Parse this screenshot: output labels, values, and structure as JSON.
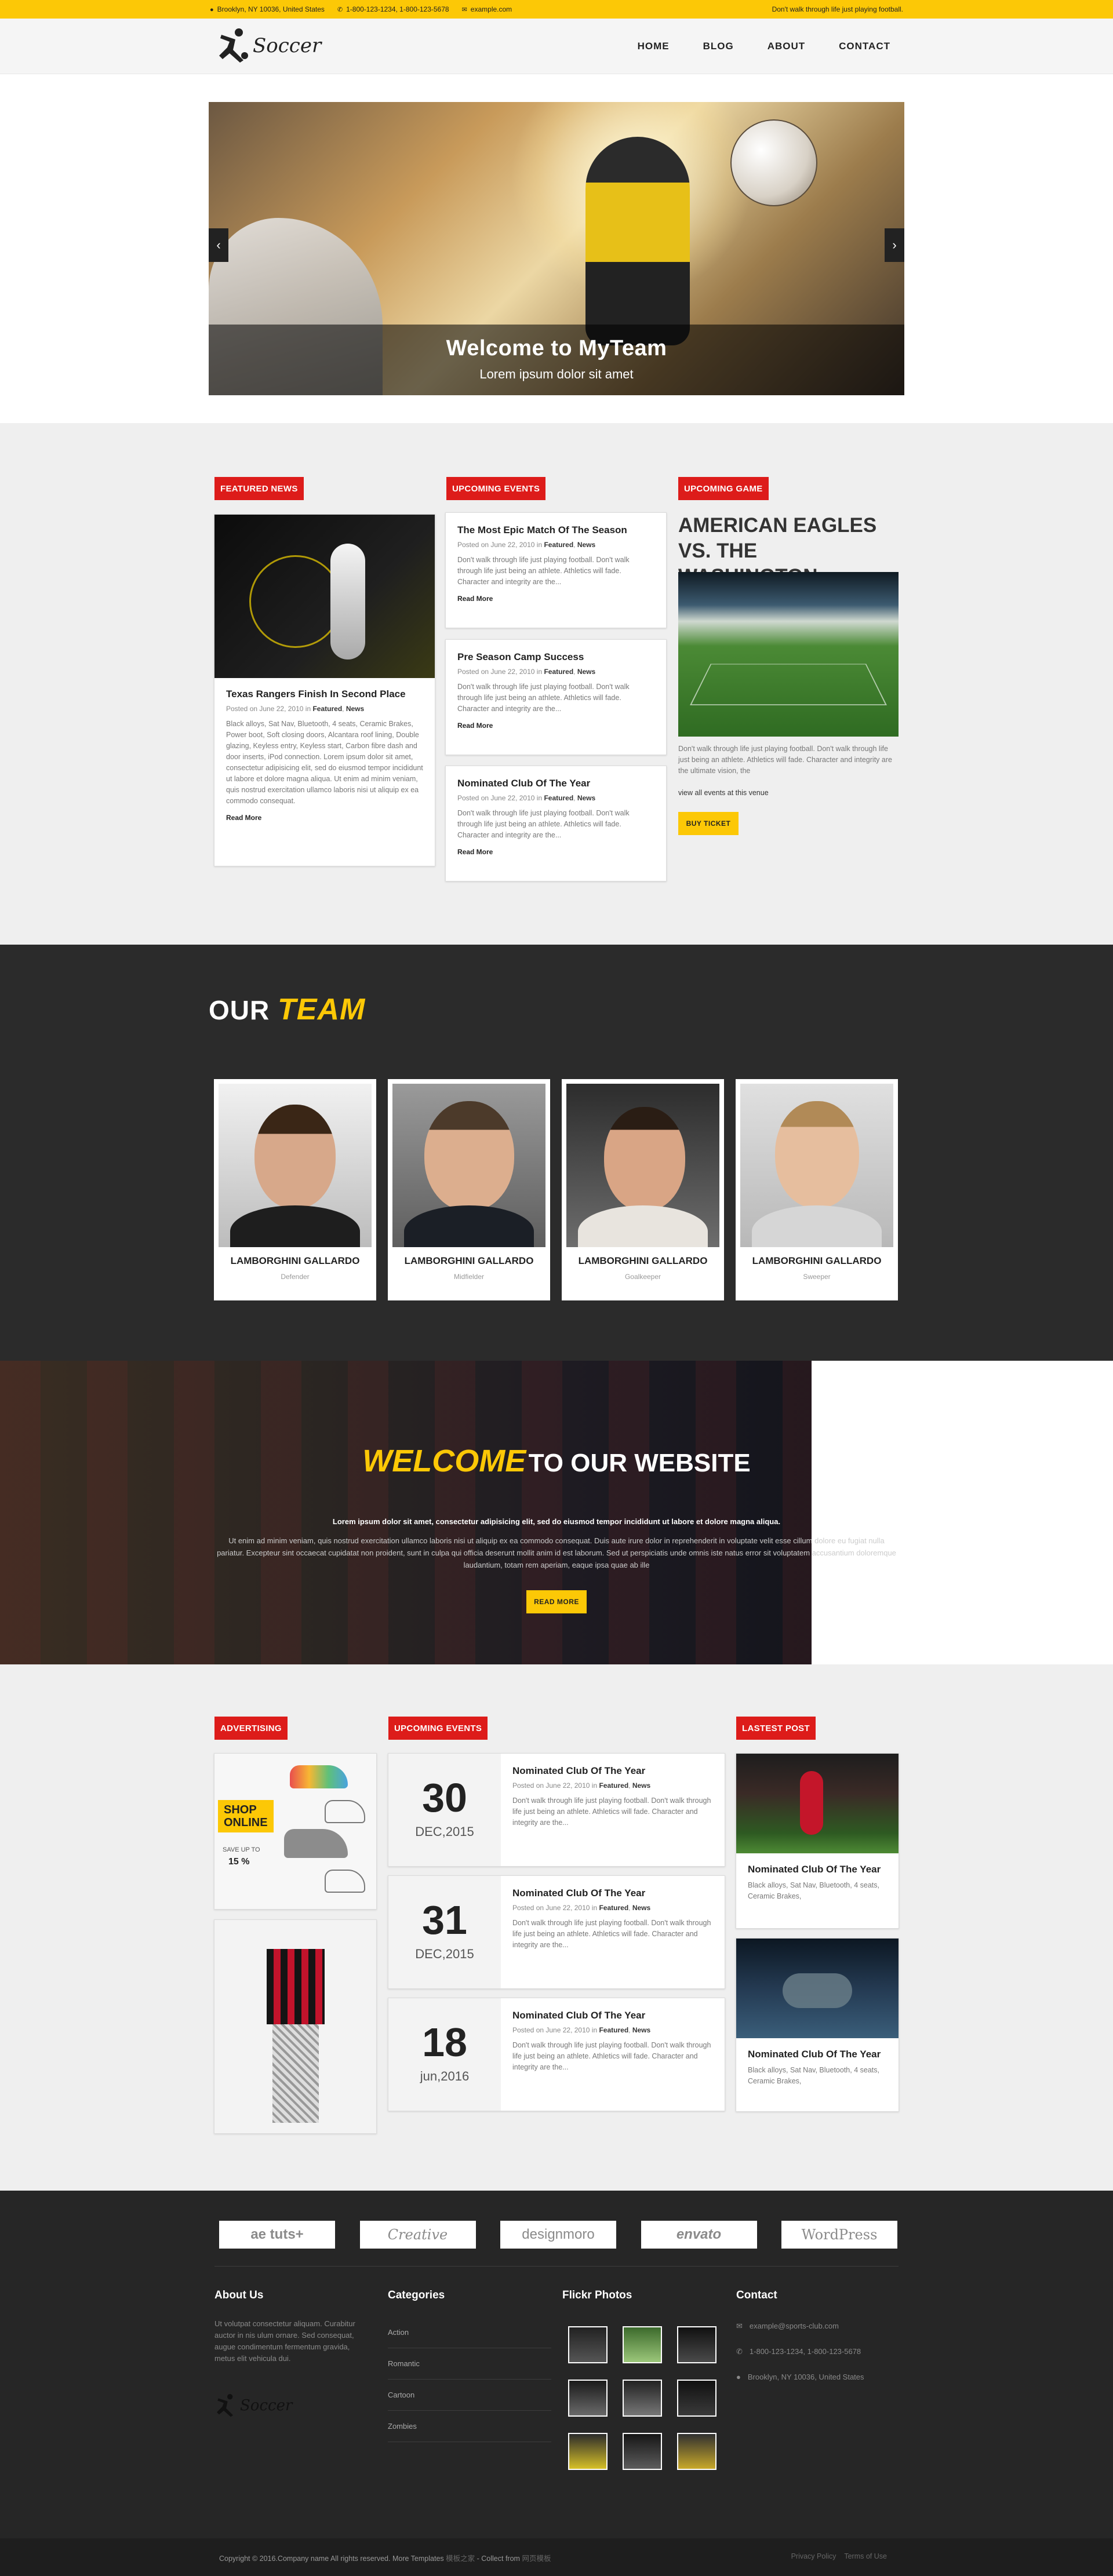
{
  "topbar": {
    "address": "Brooklyn, NY 10036, United States",
    "phones": "1-800-123-1234, 1-800-123-5678",
    "email": "example.com",
    "tagline": "Don't walk through life just playing football."
  },
  "header": {
    "logo_text": "Soccer",
    "nav": [
      "HOME",
      "BLOG",
      "ABOUT",
      "CONTACT"
    ]
  },
  "slider": {
    "title": "Welcome to MyTeam",
    "subtitle": "Lorem ipsum dolor sit amet"
  },
  "featured": {
    "label": "FEATURED NEWS",
    "title": "Texas Rangers Finish In Second Place",
    "meta_prefix": "Posted on June 22, 2010 in",
    "cat1": "Featured",
    "cat2": "News",
    "excerpt": "Black alloys, Sat Nav, Bluetooth, 4 seats, Ceramic Brakes, Power boot, Soft closing doors, Alcantara roof lining, Double glazing, Keyless entry, Keyless start, Carbon fibre dash and door inserts, iPod connection. Lorem ipsum dolor sit amet, consectetur adipisicing elit, sed do eiusmod tempor incididunt ut labore et dolore magna aliqua. Ut enim ad minim veniam, quis nostrud exercitation ullamco laboris nisi ut aliquip ex ea commodo consequat.",
    "read_more": "Read More"
  },
  "events": {
    "label": "UPCOMING EVENTS",
    "items": [
      {
        "title": "The Most Epic Match Of The Season",
        "meta_prefix": "Posted on June 22, 2010 in",
        "cat1": "Featured",
        "cat2": "News",
        "excerpt": "Don't walk through life just playing football. Don't walk through life just being an athlete. Athletics will fade. Character and integrity are the...",
        "read_more": "Read More"
      },
      {
        "title": "Pre Season Camp Success",
        "meta_prefix": "Posted on June 22, 2010 in",
        "cat1": "Featured",
        "cat2": "News",
        "excerpt": "Don't walk through life just playing football. Don't walk through life just being an athlete. Athletics will fade. Character and integrity are the...",
        "read_more": "Read More"
      },
      {
        "title": "Nominated Club Of The Year",
        "meta_prefix": "Posted on June 22, 2010 in",
        "cat1": "Featured",
        "cat2": "News",
        "excerpt": "Don't walk through life just playing football. Don't walk through life just being an athlete. Athletics will fade. Character and integrity are the...",
        "read_more": "Read More"
      }
    ]
  },
  "game": {
    "label": "UPCOMING GAME",
    "title": "AMERICAN EAGLES VS. THE WASHINGTON REDSKINS",
    "excerpt": "Don't walk through life just playing football. Don't walk through life just being an athlete. Athletics will fade. Character and integrity are the ultimate vision, the",
    "link": "view all events at this venue",
    "button": "BUY TICKET"
  },
  "team": {
    "heading_1": "OUR",
    "heading_2": "TEAM",
    "members": [
      {
        "name": "LAMBORGHINI GALLARDO",
        "role": "Defender"
      },
      {
        "name": "LAMBORGHINI GALLARDO",
        "role": "Midfielder"
      },
      {
        "name": "LAMBORGHINI GALLARDO",
        "role": "Goalkeeper"
      },
      {
        "name": "LAMBORGHINI GALLARDO",
        "role": "Sweeper"
      }
    ]
  },
  "welcome": {
    "heading_1": "WELCOME",
    "heading_2": "TO OUR WEBSITE",
    "lead": "Lorem ipsum dolor sit amet, consectetur adipisicing elit, sed do eiusmod tempor incididunt ut labore et dolore magna aliqua.",
    "body": "Ut enim ad minim veniam, quis nostrud exercitation ullamco laboris nisi ut aliquip ex ea commodo consequat. Duis aute irure dolor in reprehenderit in voluptate velit esse cillum dolore eu fugiat nulla pariatur. Excepteur sint occaecat cupidatat non proident, sunt in culpa qui officia deserunt mollit anim id est laborum. Sed ut perspiciatis unde omnis iste natus error sit voluptatem accusantium doloremque laudantium, totam rem aperiam, eaque ipsa quae ab ille",
    "button": "READ MORE"
  },
  "advertising": {
    "label": "ADVERTISING",
    "shop_1": "SHOP",
    "shop_2": "ONLINE",
    "save": "SAVE UP TO",
    "percent": "15 %"
  },
  "upcoming2": {
    "label": "UPCOMING EVENTS",
    "items": [
      {
        "day": "30",
        "date": "DEC,2015",
        "title": "Nominated Club Of The Year",
        "meta_prefix": "Posted on June 22, 2010 in",
        "cat1": "Featured",
        "cat2": "News",
        "excerpt": "Don't walk through life just playing football. Don't walk through life just being an athlete. Athletics will fade. Character and integrity are the..."
      },
      {
        "day": "31",
        "date": "DEC,2015",
        "title": "Nominated Club Of The Year",
        "meta_prefix": "Posted on June 22, 2010 in",
        "cat1": "Featured",
        "cat2": "News",
        "excerpt": "Don't walk through life just playing football. Don't walk through life just being an athlete. Athletics will fade. Character and integrity are the..."
      },
      {
        "day": "18",
        "date": "jun,2016",
        "title": "Nominated Club Of The Year",
        "meta_prefix": "Posted on June 22, 2010 in",
        "cat1": "Featured",
        "cat2": "News",
        "excerpt": "Don't walk through life just playing football. Don't walk through life just being an athlete. Athletics will fade. Character and integrity are the..."
      }
    ]
  },
  "latest": {
    "label": "LASTEST POST",
    "items": [
      {
        "title": "Nominated Club Of The Year",
        "excerpt": "Black alloys, Sat Nav, Bluetooth, 4 seats, Ceramic Brakes,"
      },
      {
        "title": "Nominated Club Of The Year",
        "excerpt": "Black alloys, Sat Nav, Bluetooth, 4 seats, Ceramic Brakes,"
      }
    ]
  },
  "partners": [
    "ae tuts+",
    "Creative",
    "designmoro",
    "envato",
    "WordPress"
  ],
  "footer": {
    "about_title": "About Us",
    "about_text": "Ut volutpat consectetur aliquam. Curabitur auctor in nis ulum ornare. Sed consequat, augue condimentum fermentum gravida, metus elit vehicula dui.",
    "logo_text": "Soccer",
    "categories_title": "Categories",
    "categories": [
      "Action",
      "Romantic",
      "Cartoon",
      "Zombies"
    ],
    "flickr_title": "Flickr Photos",
    "contact_title": "Contact",
    "contact_email": "example@sports-club.com",
    "contact_phone": "1-800-123-1234, 1-800-123-5678",
    "contact_address": "Brooklyn, NY 10036, United States",
    "copyright": "Copyright © 2016.Company name All rights reserved.",
    "more": "More Templates",
    "more_link": "模板之家",
    "collect": "- Collect from",
    "collect_link": "网页模板",
    "privacy": "Privacy Policy",
    "terms": "Terms of Use"
  }
}
